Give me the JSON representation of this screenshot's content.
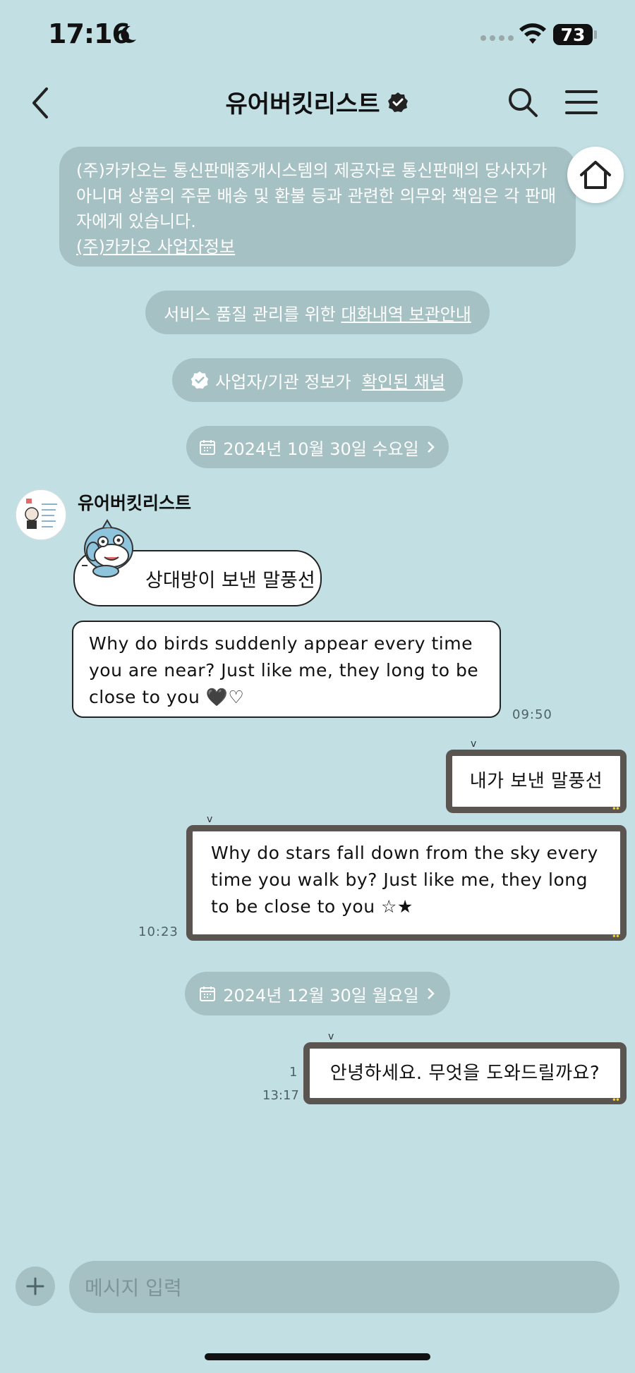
{
  "status_bar": {
    "time": "17:16",
    "battery": "73"
  },
  "header": {
    "title": "유어버킷리스트"
  },
  "notice": {
    "text": "(주)카카오는 통신판매중개시스템의 제공자로 통신판매의 당사자가 아니며 상품의 주문 배송 및 환불 등과 관련한 의무와 책임은 각 판매자에게 있습니다.",
    "link": "(주)카카오 사업자정보"
  },
  "service_notice": {
    "prefix": "서비스 품질 관리를 위한 ",
    "link": "대화내역 보관안내"
  },
  "verified_notice": {
    "prefix": "사업자/기관 정보가 ",
    "link": "확인된 채널"
  },
  "date_dividers": [
    "2024년 10월 30일 수요일",
    "2024년 12월 30일 월요일"
  ],
  "incoming": {
    "sender": "유어버킷리스트",
    "messages": [
      "상대방이 보낸 말풍선",
      "Why do birds suddenly appear every time you are near? Just like me, they long to be close to you 🖤♡"
    ],
    "time": "09:50"
  },
  "outgoing": [
    {
      "text": "내가 보낸 말풍선"
    },
    {
      "text": "Why do stars fall down from the sky every time you walk by? Just like me, they long to be close to you ☆★",
      "time": "10:23"
    },
    {
      "text": "안녕하세요. 무엇을 도와드릴까요?",
      "time": "13:17",
      "unread": "1"
    }
  ],
  "input": {
    "placeholder": "메시지 입력"
  },
  "icons": [
    "moon-icon",
    "wifi-icon",
    "back-icon",
    "verified-icon",
    "search-icon",
    "menu-icon",
    "home-icon",
    "calendar-icon",
    "plus-icon"
  ],
  "colors": {
    "background": "#c2e0e4",
    "pill": "#a5c1c4",
    "bubble_border_out": "#5a5550"
  }
}
